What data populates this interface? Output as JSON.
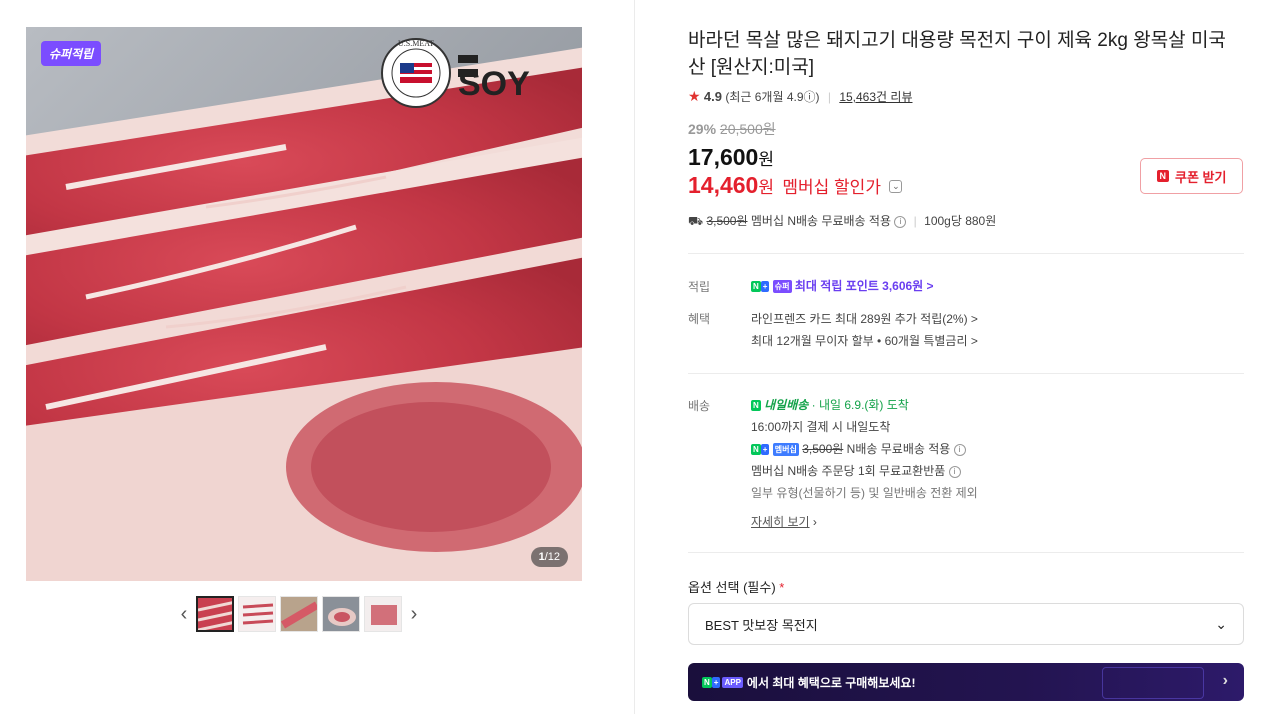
{
  "gallery": {
    "badge": "슈퍼적립",
    "logo_text": "SOY",
    "logo_seal_text": "U.S.MEAT EXPORT FEDERATION",
    "counter_current": "1",
    "counter_total": "/12",
    "prev": "‹",
    "next": "›"
  },
  "product": {
    "title": "바라던 목살 많은 돼지고기 대용량 목전지 구이 제육 2kg 왕목살 미국산 [원산지:미국]",
    "rating": "4.9",
    "rating_recent": "(최근 6개월 4.9ⓘ)",
    "reviews": "15,463건 리뷰",
    "discount_rate": "29%",
    "original_price": "20,500원",
    "price": "17,600",
    "price_unit": "원",
    "member_price": "14,460",
    "member_price_unit": "원",
    "member_label": "멤버십 할인가",
    "coupon_label": "쿠폰 받기",
    "shipping_fee_struck": "3,500원",
    "shipping_text": "멤버십 N배송 무료배송 적용",
    "unit_price": "100g당 880원"
  },
  "benefits": {
    "points_label": "적립",
    "points_text": "최대 적립 포인트 3,606원 >",
    "benefit_label": "혜택",
    "card_text": "라인프렌즈 카드 최대 289원 추가 적립(2%) >",
    "installment_text": "최대 12개월 무이자 할부 • 60개월 특별금리 >"
  },
  "delivery": {
    "label": "배송",
    "tomorrow_badge": "내일배송",
    "arrival": "· 내일 6.9.(화) 도착",
    "cutoff": "16:00까지 결제 시 내일도착",
    "fee_struck": "3,500원",
    "fee_text": "N배송 무료배송 적용",
    "exchange": "멤버십 N배송 주문당 1회 무료교환반품",
    "exclusion": "일부 유형(선물하기 등) 및 일반배송 전환 제외",
    "more": "자세히 보기"
  },
  "options": {
    "label": "옵션 선택 (필수)",
    "required_mark": "*",
    "selected": "BEST 맛보장 목전지"
  },
  "app_banner": {
    "text": "에서 최대 혜택으로 구매해보세요!",
    "app_badge": "APP"
  },
  "colors": {
    "accent_red": "#e4202d",
    "super_badge": "#7b4dff",
    "naver_green": "#03c75a"
  }
}
